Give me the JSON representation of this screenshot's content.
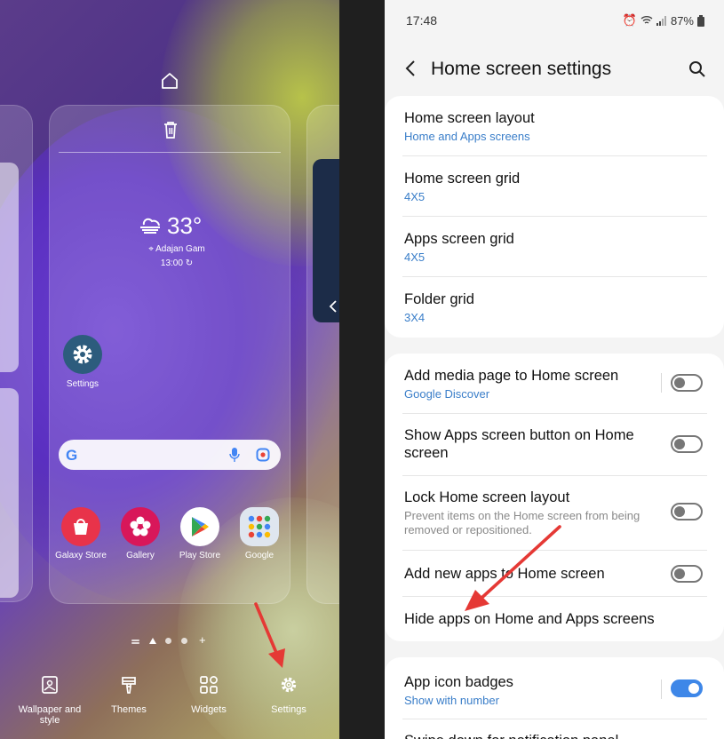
{
  "left_panel": {
    "weather": {
      "temperature": "33°",
      "location": "Adajan Gam",
      "time": "13:00"
    },
    "settings_app_label": "Settings",
    "dock_apps": [
      {
        "label": "Galaxy Store",
        "icon": "galaxy-store-icon"
      },
      {
        "label": "Gallery",
        "icon": "gallery-icon"
      },
      {
        "label": "Play Store",
        "icon": "play-store-icon"
      },
      {
        "label": "Google",
        "icon": "google-folder-icon"
      }
    ],
    "toolbar": [
      {
        "label": "Wallpaper and style",
        "icon": "wallpaper-icon"
      },
      {
        "label": "Themes",
        "icon": "themes-icon"
      },
      {
        "label": "Widgets",
        "icon": "widgets-icon"
      },
      {
        "label": "Settings",
        "icon": "gear-icon"
      }
    ],
    "colors": {
      "settings_icon_bg": "#2d5c7d",
      "galaxy_store": "#e8334a",
      "gallery": "#d8175a",
      "arrow": "#e53935"
    }
  },
  "right_panel": {
    "status": {
      "time": "17:48",
      "battery": "87%"
    },
    "title": "Home screen settings",
    "group1": [
      {
        "title": "Home screen layout",
        "subtitle": "Home and Apps screens"
      },
      {
        "title": "Home screen grid",
        "subtitle": "4X5"
      },
      {
        "title": "Apps screen grid",
        "subtitle": "4X5"
      },
      {
        "title": "Folder grid",
        "subtitle": "3X4"
      }
    ],
    "group2": {
      "media_page": {
        "title": "Add media page to Home screen",
        "subtitle": "Google Discover",
        "enabled": false
      },
      "apps_button": {
        "title_line1": "Show Apps screen button on Home",
        "title_line2": "screen",
        "enabled": false
      },
      "lock_layout": {
        "title": "Lock Home screen layout",
        "desc_line1": "Prevent items on the Home screen from being",
        "desc_line2": "removed or repositioned.",
        "enabled": false
      },
      "add_new_apps": {
        "title": "Add new apps to Home screen",
        "enabled": false
      },
      "hide_apps": {
        "title": "Hide apps on Home and Apps screens"
      }
    },
    "group3": {
      "badges": {
        "title": "App icon badges",
        "subtitle": "Show with number",
        "enabled": true
      },
      "swipe": {
        "title": "Swipe down for notification panel"
      }
    },
    "colors": {
      "link": "#3a7ec9",
      "toggle_on": "#3e87e8",
      "background": "#f4f4f4"
    }
  }
}
